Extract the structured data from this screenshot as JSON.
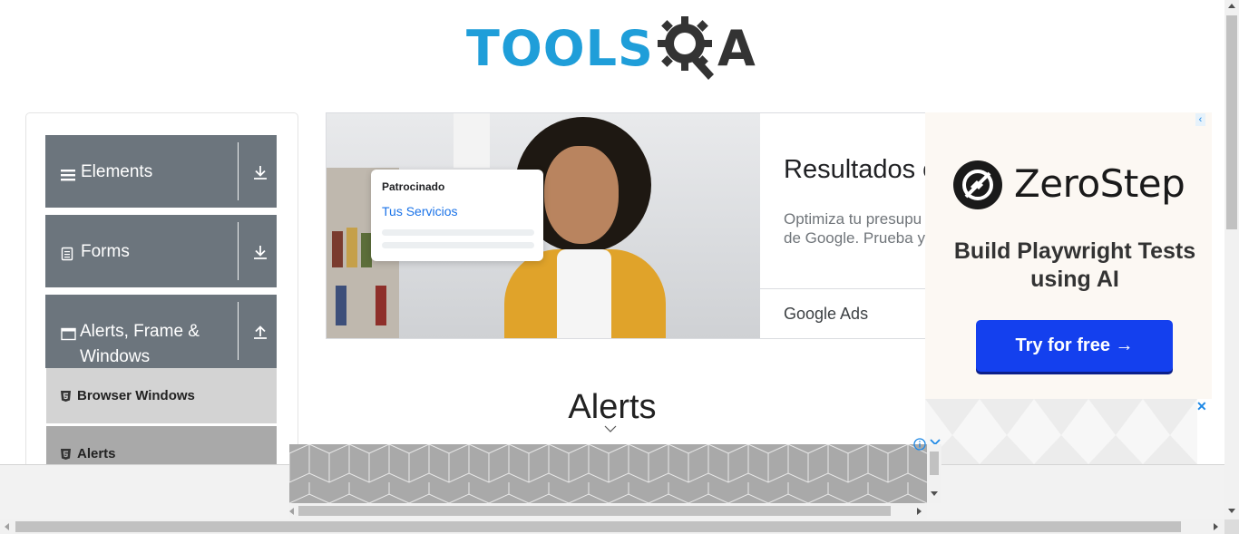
{
  "header": {
    "logo_text": "TOOLS",
    "logo_suffix": "A"
  },
  "sidebar": {
    "groups": [
      {
        "label": "Elements",
        "icon": "hamburger-icon",
        "toggle": "download-arrow-icon"
      },
      {
        "label": "Forms",
        "icon": "document-icon",
        "toggle": "download-arrow-icon"
      },
      {
        "label": "Alerts, Frame & Windows",
        "icon": "window-icon",
        "toggle": "upload-arrow-icon"
      }
    ],
    "items": [
      {
        "label": "Browser Windows",
        "icon": "html5-icon"
      },
      {
        "label": "Alerts",
        "icon": "html5-icon"
      }
    ]
  },
  "center_ad": {
    "card_sponsor": "Patrocinado",
    "card_link": "Tus Servicios",
    "title": "Resultados c",
    "desc_line1": "Optimiza tu presupu",
    "desc_line2": "de Google. Prueba y",
    "brand": "Google Ads"
  },
  "right_ad": {
    "brand": "ZeroStep",
    "tagline": "Build Playwright Tests using AI",
    "cta": "Try for free →",
    "colors": {
      "cta": "#1440ee",
      "background": "#fcf8f3"
    }
  },
  "main": {
    "title": "Alerts"
  },
  "colors": {
    "brand_blue": "#1f9ed9",
    "sidebar_group": "#6c757d",
    "sidebar_active": "#d3d3d3",
    "sidebar_item": "#a9a9a9"
  }
}
